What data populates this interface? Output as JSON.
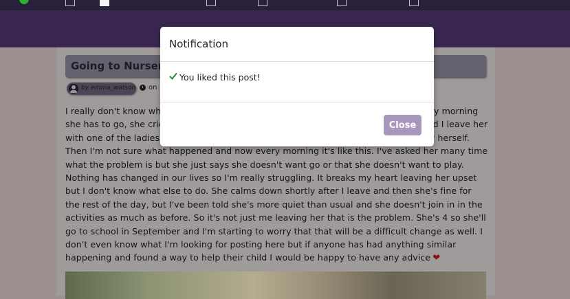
{
  "post": {
    "title": "Going to Nursery",
    "author": "by emma_watson",
    "date_prefix": "on",
    "body": "I really don't know what to do. My daughter goes to nursery 3 days a week and every morning she has to go, she cries and says she doesn't want to go. She used to want to go and I leave her with one of the ladies there and she would have hugs and then be fine walking in by herself. Then I'm not sure what happened and now every morning it's like this. I've asked her many time what the problem is but she just says she doesn't want go or that she doesn't want to play. Nothing has changed in our lives so I'm really struggling. It breaks my heart leaving her upset but I don't know what else to do. She calms down shortly after I leave and then she's fine for the rest of the day, but I've been told she's more quiet than usual and she doesn't join in in the activities as much as before. So it's not just me leaving her that is the problem. She's 4 so she'll go to school in September and I'm starting to worry that that will be a difficult change as well. I don't even know what I'm looking for posting here but if anyone has had anything similar happening and found a way to help their child I would be happy to have any advice",
    "heart": "❤"
  },
  "modal": {
    "title": "Notification",
    "message": "You liked this post!",
    "close_label": "Close"
  }
}
